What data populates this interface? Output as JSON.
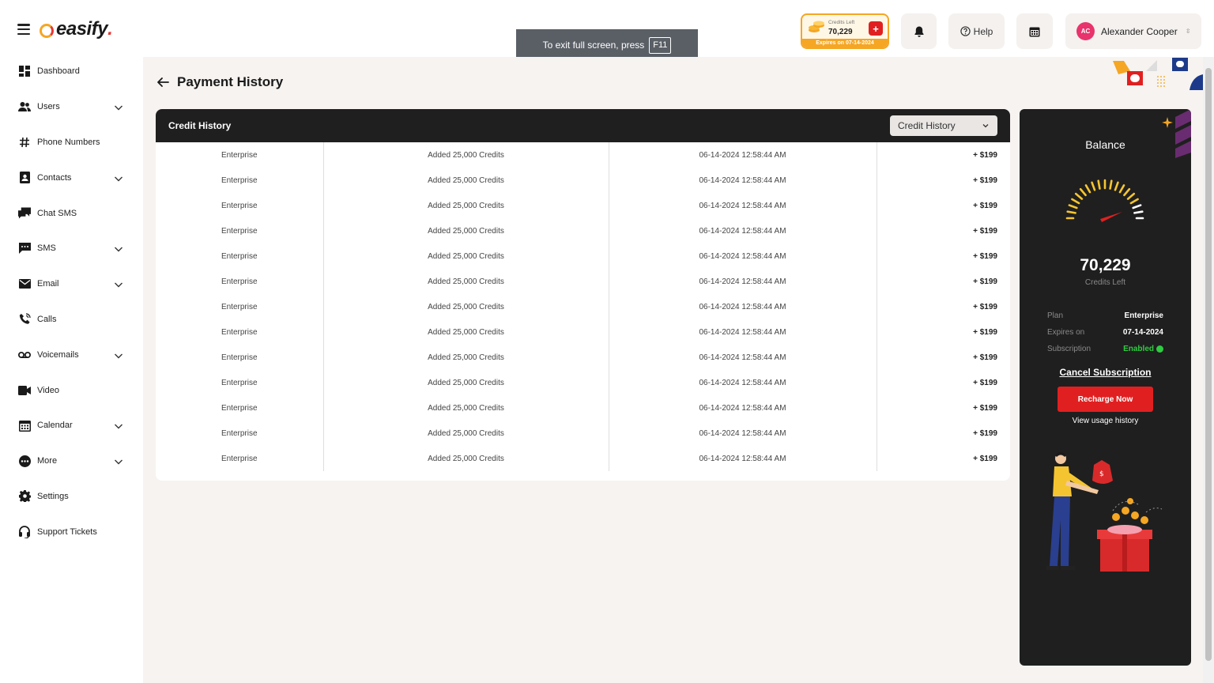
{
  "brand": {
    "name": "easify",
    "dot": "."
  },
  "sidebar": {
    "items": [
      {
        "label": "Dashboard",
        "icon": "dashboard-icon",
        "expandable": false
      },
      {
        "label": "Users",
        "icon": "users-icon",
        "expandable": true
      },
      {
        "label": "Phone Numbers",
        "icon": "hash-icon",
        "expandable": false
      },
      {
        "label": "Contacts",
        "icon": "contacts-icon",
        "expandable": true
      },
      {
        "label": "Chat SMS",
        "icon": "chat-icon",
        "expandable": false
      },
      {
        "label": "SMS",
        "icon": "sms-icon",
        "expandable": true
      },
      {
        "label": "Email",
        "icon": "email-icon",
        "expandable": true
      },
      {
        "label": "Calls",
        "icon": "phone-icon",
        "expandable": false
      },
      {
        "label": "Voicemails",
        "icon": "voicemail-icon",
        "expandable": true
      },
      {
        "label": "Video",
        "icon": "video-icon",
        "expandable": false
      },
      {
        "label": "Calendar",
        "icon": "calendar-icon",
        "expandable": true
      },
      {
        "label": "More",
        "icon": "more-icon",
        "expandable": true
      },
      {
        "label": "Settings",
        "icon": "gear-icon",
        "expandable": false
      },
      {
        "label": "Support Tickets",
        "icon": "headset-icon",
        "expandable": false
      }
    ]
  },
  "header": {
    "credits_label": "Credits Left",
    "credits_value": "70,229",
    "credits_plus": "+",
    "credits_expiry": "Expires on 07-14-2024",
    "help_label": "Help",
    "user_initials": "AC",
    "user_name": "Alexander Cooper"
  },
  "fullscreen_toast": {
    "text": "To exit full screen, press",
    "key": "F11"
  },
  "page": {
    "title": "Payment History"
  },
  "history": {
    "title": "Credit History",
    "filter_value": "Credit History",
    "rows": [
      {
        "plan": "Enterprise",
        "description": "Added 25,000 Credits",
        "date": "06-14-2024 12:58:44 AM",
        "amount": "+ $199"
      },
      {
        "plan": "Enterprise",
        "description": "Added 25,000 Credits",
        "date": "06-14-2024 12:58:44 AM",
        "amount": "+ $199"
      },
      {
        "plan": "Enterprise",
        "description": "Added 25,000 Credits",
        "date": "06-14-2024 12:58:44 AM",
        "amount": "+ $199"
      },
      {
        "plan": "Enterprise",
        "description": "Added 25,000 Credits",
        "date": "06-14-2024 12:58:44 AM",
        "amount": "+ $199"
      },
      {
        "plan": "Enterprise",
        "description": "Added 25,000 Credits",
        "date": "06-14-2024 12:58:44 AM",
        "amount": "+ $199"
      },
      {
        "plan": "Enterprise",
        "description": "Added 25,000 Credits",
        "date": "06-14-2024 12:58:44 AM",
        "amount": "+ $199"
      },
      {
        "plan": "Enterprise",
        "description": "Added 25,000 Credits",
        "date": "06-14-2024 12:58:44 AM",
        "amount": "+ $199"
      },
      {
        "plan": "Enterprise",
        "description": "Added 25,000 Credits",
        "date": "06-14-2024 12:58:44 AM",
        "amount": "+ $199"
      },
      {
        "plan": "Enterprise",
        "description": "Added 25,000 Credits",
        "date": "06-14-2024 12:58:44 AM",
        "amount": "+ $199"
      },
      {
        "plan": "Enterprise",
        "description": "Added 25,000 Credits",
        "date": "06-14-2024 12:58:44 AM",
        "amount": "+ $199"
      },
      {
        "plan": "Enterprise",
        "description": "Added 25,000 Credits",
        "date": "06-14-2024 12:58:44 AM",
        "amount": "+ $199"
      },
      {
        "plan": "Enterprise",
        "description": "Added 25,000 Credits",
        "date": "06-14-2024 12:58:44 AM",
        "amount": "+ $199"
      },
      {
        "plan": "Enterprise",
        "description": "Added 25,000 Credits",
        "date": "06-14-2024 12:58:44 AM",
        "amount": "+ $199"
      }
    ]
  },
  "balance": {
    "title": "Balance",
    "credits": "70,229",
    "credits_sub": "Credits Left",
    "plan_label": "Plan",
    "plan_value": "Enterprise",
    "expires_label": "Expires on",
    "expires_value": "07-14-2024",
    "subscription_label": "Subscription",
    "subscription_value": "Enabled",
    "cancel_label": "Cancel Subscription",
    "recharge_label": "Recharge Now",
    "usage_label": "View usage history"
  },
  "colors": {
    "accent_red": "#e02020",
    "accent_orange": "#f5a623",
    "dark_panel": "#1f1f1f",
    "success_green": "#2ecc40",
    "main_bg": "#f6f3f1"
  }
}
